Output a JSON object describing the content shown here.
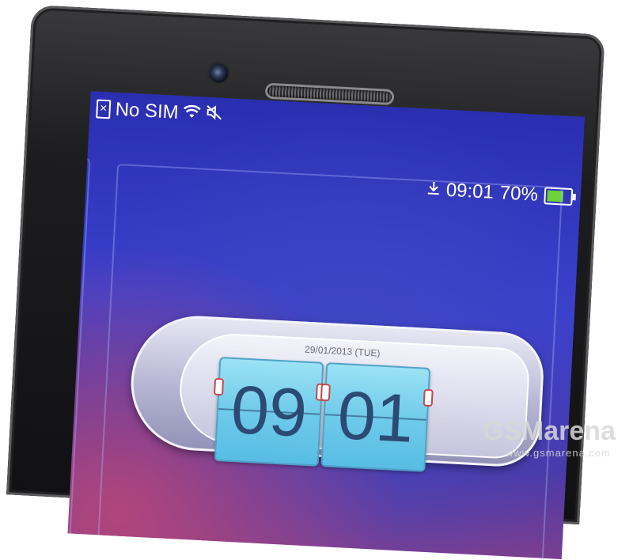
{
  "statusbar": {
    "carrier_text": "No SIM",
    "icons": [
      "sim-card-icon",
      "wifi-icon",
      "mute-icon",
      "download-icon",
      "battery-icon"
    ],
    "time": "09:01",
    "battery": "70%",
    "battery_level": 0.7,
    "battery_color": "#6bd23a"
  },
  "clock_widget": {
    "date": "29/01/2013 (TUE)",
    "hours": "09",
    "minutes": "01",
    "flip_color": "#6fcbea"
  },
  "watermark": {
    "brand": "GSMarena",
    "url": "www.gsmarena.com"
  }
}
